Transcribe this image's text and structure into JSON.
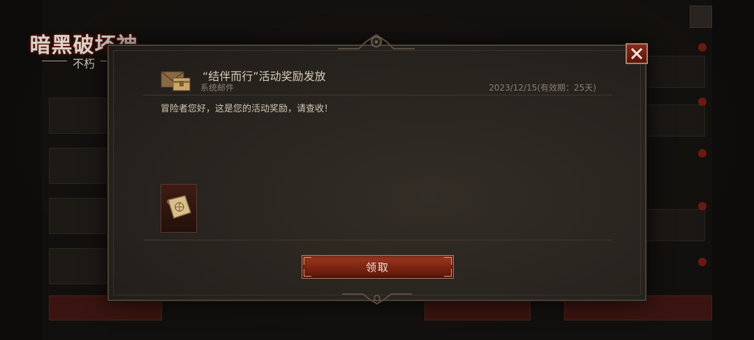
{
  "logo": {
    "title": "暗黑破坏神",
    "subtitle": "不朽"
  },
  "mail": {
    "title": "“结伴而行”活动奖励发放",
    "sender": "系统邮件",
    "date": "2023/12/15(有效期：25天)",
    "body": "冒险者您好，这是您的活动奖励，请查收！"
  },
  "attachments": [
    {
      "icon": "scroll-map-icon"
    }
  ],
  "buttons": {
    "claim_label": "领取",
    "close_icon": "close-icon"
  },
  "colors": {
    "accent_red": "#8a2a1e",
    "text_primary": "#d8cdbb",
    "text_secondary": "#8a8074"
  }
}
